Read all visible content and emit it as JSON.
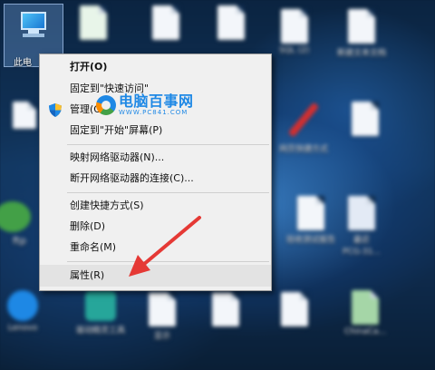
{
  "desktop": {
    "this_pc_label": "此电",
    "left_partial_label": "ftp",
    "icons": [
      {
        "label": "SQL (2)"
      },
      {
        "label": "新建文本文档"
      },
      {
        "label": "网页快捷方式"
      },
      {
        "label": "验收测试报告"
      },
      {
        "label": "最近"
      },
      {
        "label": "PCG-31..."
      },
      {
        "label": "Lenovo"
      },
      {
        "label": "驱动精灵工具"
      },
      {
        "label": "显示"
      },
      {
        "label": "ChinaCa..."
      }
    ]
  },
  "watermark": {
    "title": "电脑百事网",
    "url": "WWW.PC841.COM"
  },
  "context_menu": {
    "items": [
      {
        "label": "打开(O)"
      },
      {
        "label": "固定到\"快速访问\""
      },
      {
        "label": "管理(G)"
      },
      {
        "label": "固定到\"开始\"屏幕(P)"
      },
      {
        "label": "映射网络驱动器(N)..."
      },
      {
        "label": "断开网络驱动器的连接(C)..."
      },
      {
        "label": "创建快捷方式(S)"
      },
      {
        "label": "删除(D)"
      },
      {
        "label": "重命名(M)"
      },
      {
        "label": "属性(R)"
      }
    ]
  },
  "colors": {
    "menu_bg": "#f0f0f0",
    "highlight": "#e3e3e3",
    "arrow": "#e53935",
    "watermark": "#1e88e5"
  }
}
